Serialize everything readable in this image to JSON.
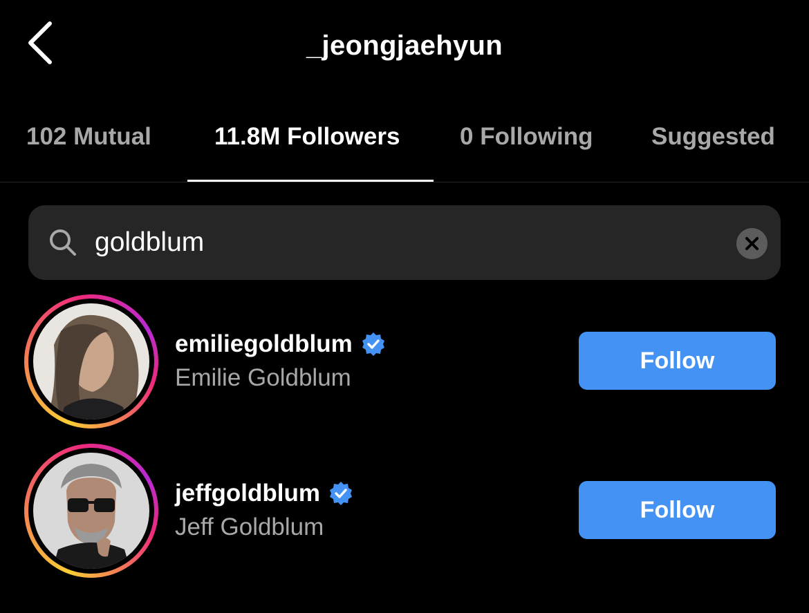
{
  "header": {
    "title": "_jeongjaehyun",
    "back_icon": "chevron-left-icon"
  },
  "tabs": [
    {
      "label": "102 Mutual",
      "active": false
    },
    {
      "label": "11.8M Followers",
      "active": true
    },
    {
      "label": "0 Following",
      "active": false
    },
    {
      "label": "Suggested",
      "active": false
    }
  ],
  "search": {
    "value": "goldblum",
    "icon": "search-icon",
    "clear_icon": "clear-icon"
  },
  "results": [
    {
      "username": "emiliegoldblum",
      "full_name": "Emilie Goldblum",
      "verified": true,
      "button_label": "Follow"
    },
    {
      "username": "jeffgoldblum",
      "full_name": "Jeff Goldblum",
      "verified": true,
      "button_label": "Follow"
    }
  ],
  "colors": {
    "background": "#000000",
    "follow_button": "#4492f3",
    "verified_badge": "#4492f3",
    "secondary_text": "#a8a8a8",
    "search_background": "#262626"
  }
}
